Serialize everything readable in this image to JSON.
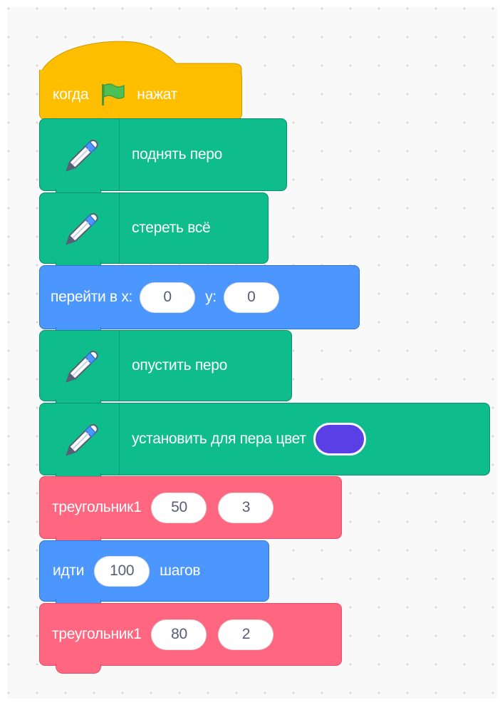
{
  "blocks": {
    "when_flag": {
      "label_before": "когда",
      "label_after": "нажат",
      "icon": "green-flag-icon"
    },
    "pen_up": {
      "label": "поднять перо",
      "icon": "pen-icon"
    },
    "clear": {
      "label": "стереть всё",
      "icon": "pen-icon"
    },
    "goto": {
      "label": "перейти в x:",
      "x_value": "0",
      "y_label": "y:",
      "y_value": "0"
    },
    "pen_down": {
      "label": "опустить перо",
      "icon": "pen-icon"
    },
    "set_pen_color": {
      "label": "установить для пера цвет",
      "color": "#5a3ee6",
      "icon": "pen-icon"
    },
    "triangle_1": {
      "label": "треугольник1",
      "arg1": "50",
      "arg2": "3"
    },
    "move": {
      "label_before": "идти",
      "steps": "100",
      "label_after": "шагов"
    },
    "triangle_2": {
      "label": "треугольник1",
      "arg1": "80",
      "arg2": "2"
    }
  },
  "colors": {
    "events": "#ffbf00",
    "pen": "#0fbd8c",
    "motion": "#4c97ff",
    "custom": "#ff6680"
  }
}
